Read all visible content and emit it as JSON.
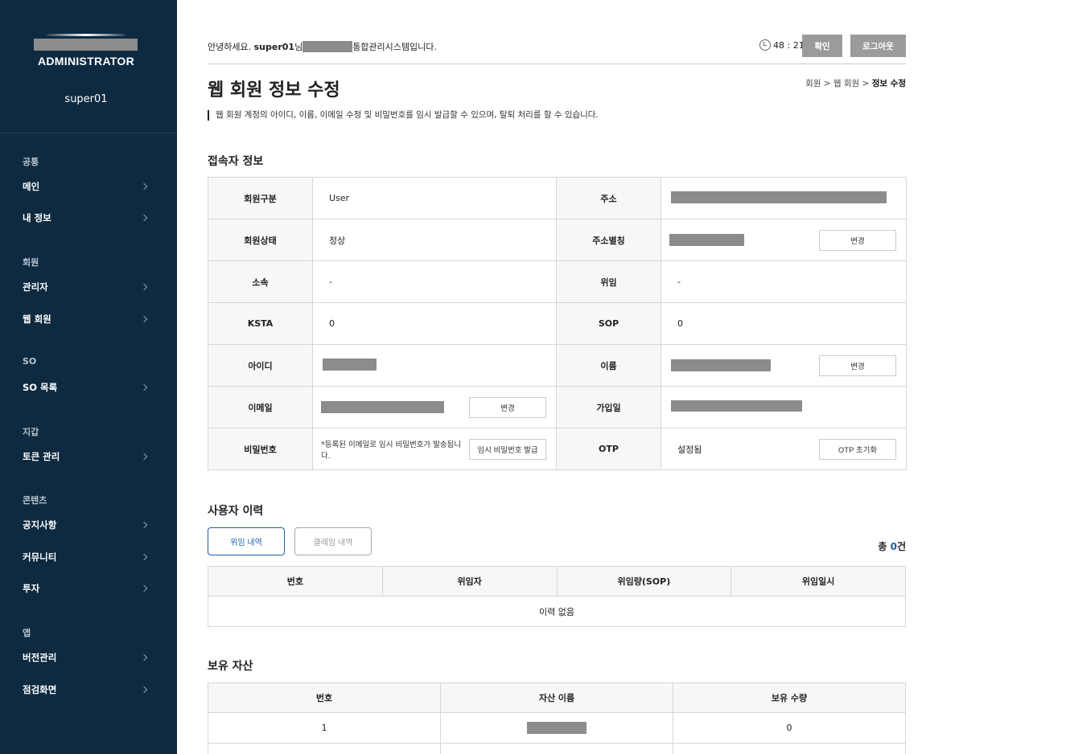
{
  "sidebar": {
    "brand": "ADMINISTRATOR",
    "user": "super01",
    "sections": [
      {
        "title": "공통",
        "items": [
          "메인",
          "내 정보"
        ]
      },
      {
        "title": "회원",
        "items": [
          "관리자",
          "웹 회원"
        ]
      },
      {
        "title": "SO",
        "items": [
          "SO 목록"
        ]
      },
      {
        "title": "지갑",
        "items": [
          "토큰 관리"
        ]
      },
      {
        "title": "콘텐츠",
        "items": [
          "공지사항",
          "커뮤니티",
          "투자"
        ]
      },
      {
        "title": "앱",
        "items": [
          "버전관리",
          "점검화면"
        ]
      }
    ]
  },
  "header": {
    "greet_prefix": "안녕하세요.",
    "greet_user": "super01",
    "greet_mid": "님",
    "greet_suffix": "통합관리시스템입니다.",
    "timer": "48 : 21",
    "confirm_label": "확인",
    "logout_label": "로그아웃"
  },
  "page": {
    "title": "웹 회원 정보 수정",
    "breadcrumb": [
      "회원",
      "웹 회원",
      "정보 수정"
    ],
    "description": "웹 회원 계정의 아이디, 이름, 이메일 수정 및 비밀번호를 임시 발급할 수 있으며, 탈퇴 처리를 할 수 있습니다."
  },
  "info": {
    "section_title": "접속자 정보",
    "change_label": "변경",
    "member_type_label": "회원구분",
    "member_type": "User",
    "address_label": "주소",
    "status_label": "회원상태",
    "status": "정상",
    "address_alias_label": "주소별칭",
    "affiliation_label": "소속",
    "affiliation": "-",
    "delegation_label": "위임",
    "delegation": "-",
    "ksta_label": "KSTA",
    "ksta": "0",
    "sop_label": "SOP",
    "sop": "0",
    "id_label": "아이디",
    "name_label": "이름",
    "email_label": "이메일",
    "joined_label": "가입일",
    "password_label": "비밀번호",
    "password_note": "*등록된 이메일로 임시 비밀번호가 발송됩니다.",
    "temp_password_button": "임시 비밀번호 발급",
    "otp_label": "OTP",
    "otp_status": "설정됨",
    "otp_reset_button": "OTP 초기화"
  },
  "history": {
    "section_title": "사용자 이력",
    "tabs": [
      "위임 내역",
      "클레임 내역"
    ],
    "total_prefix": "총 ",
    "total_count": "0",
    "total_suffix": "건",
    "columns": [
      "번호",
      "위임자",
      "위임량(SOP)",
      "위임일시"
    ],
    "empty": "이력 없음"
  },
  "assets": {
    "section_title": "보유 자산",
    "columns": [
      "번호",
      "자산 이름",
      "보유 수량"
    ],
    "rows": [
      {
        "no": "1",
        "qty": "0"
      }
    ]
  }
}
